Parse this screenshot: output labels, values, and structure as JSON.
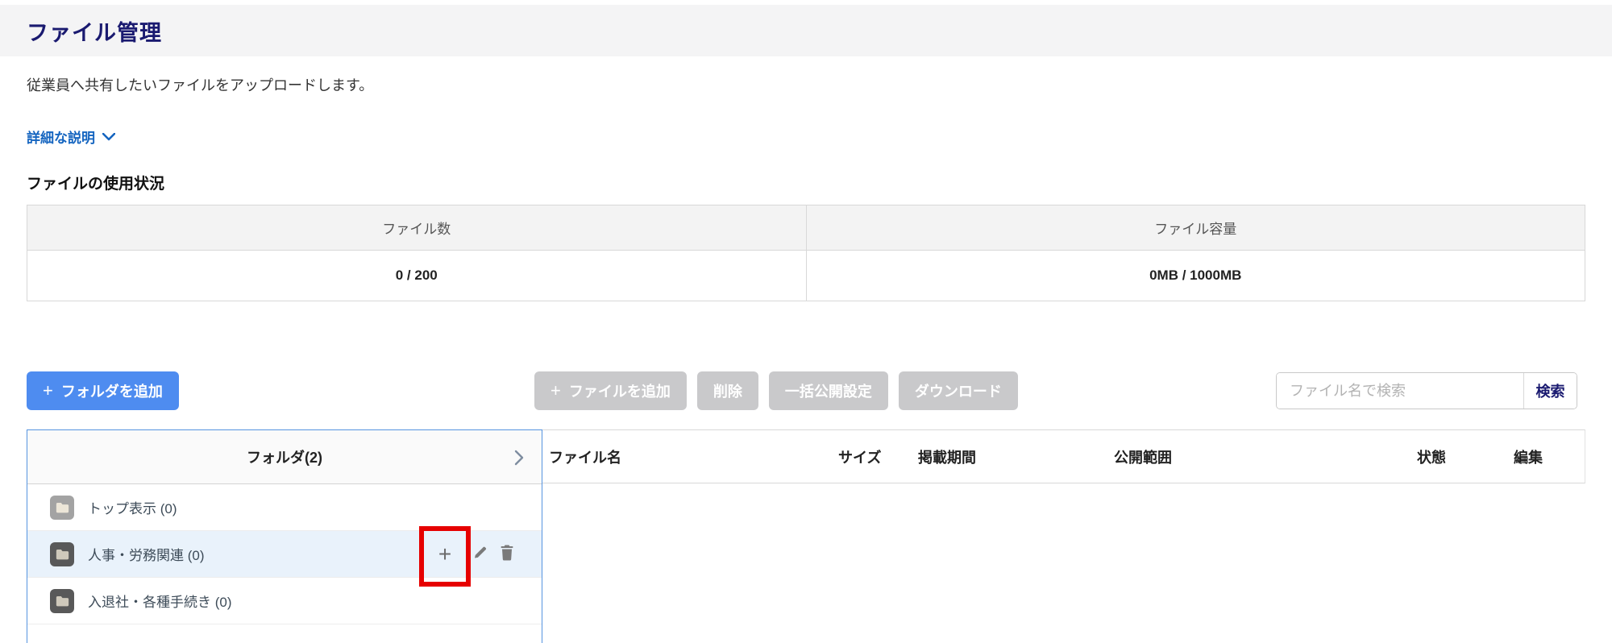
{
  "colors": {
    "accent_blue": "#4e8cf0",
    "link_blue": "#1565c0",
    "title_navy": "#1a1a70",
    "disabled_gray": "#c9c9cb",
    "row_highlight": "#e9f2fb",
    "panel_border_blue": "#5694e0",
    "annotation_red": "#e60000"
  },
  "icons": {
    "plus": "+"
  },
  "header": {
    "title": "ファイル管理"
  },
  "intro": {
    "description": "従業員へ共有したいファイルをアップロードします。",
    "details_link": "詳細な説明"
  },
  "usage": {
    "section_title": "ファイルの使用状況",
    "columns": [
      {
        "label": "ファイル数",
        "value": "0 / 200"
      },
      {
        "label": "ファイル容量",
        "value": "0MB / 1000MB"
      }
    ]
  },
  "toolbar": {
    "add_folder_label": "フォルダを追加",
    "add_file_label": "ファイルを追加",
    "delete_label": "削除",
    "bulk_publish_label": "一括公開設定",
    "download_label": "ダウンロード",
    "search_placeholder": "ファイル名で検索",
    "search_label": "検索"
  },
  "folder_panel": {
    "header": "フォルダ(2)",
    "items": [
      {
        "label": "トップ表示 (0)"
      },
      {
        "label": "人事・労務関連 (0)"
      },
      {
        "label": "入退社・各種手続き (0)"
      }
    ]
  },
  "file_table": {
    "columns": [
      {
        "label": "ファイル名"
      },
      {
        "label": "サイズ"
      },
      {
        "label": "掲載期間"
      },
      {
        "label": "公開範囲"
      },
      {
        "label": "状態"
      },
      {
        "label": "編集"
      }
    ]
  }
}
